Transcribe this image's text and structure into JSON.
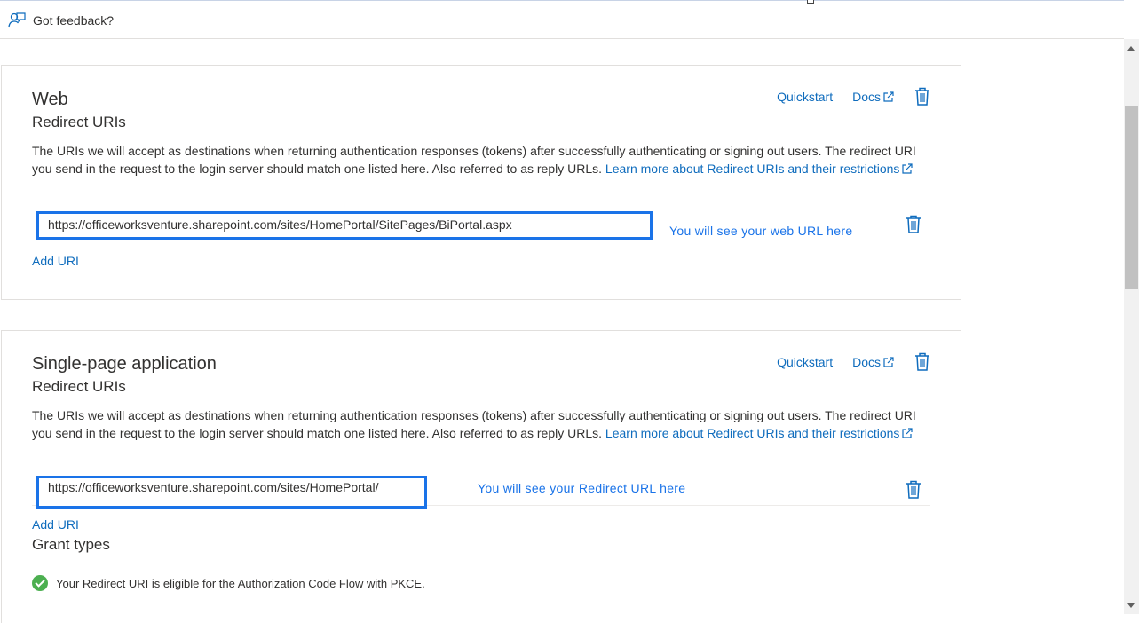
{
  "feedback": {
    "label": "Got feedback?"
  },
  "web": {
    "title": "Web",
    "subtitle": "Redirect URIs",
    "quickstart": "Quickstart",
    "docs": "Docs",
    "desc_1": "The URIs we will accept as destinations when returning authentication responses (tokens) after successfully authenticating or signing out users. The redirect URI you send in the request to the login server should match one listed here. Also referred to as reply URLs. ",
    "desc_link": "Learn more about Redirect URIs and their restrictions",
    "uri_value": "https://officeworksventure.sharepoint.com/sites/HomePortal/SitePages/BiPortal.aspx",
    "uri_note": "You will see your web URL here",
    "add_uri": "Add URI"
  },
  "spa": {
    "title": "Single-page application",
    "subtitle": "Redirect URIs",
    "quickstart": "Quickstart",
    "docs": "Docs",
    "desc_1": "The URIs we will accept as destinations when returning authentication responses (tokens) after successfully authenticating or signing out users. The redirect URI you send in the request to the login server should match one listed here. Also referred to as reply URLs. ",
    "desc_link": "Learn more about Redirect URIs and their restrictions",
    "uri_value": "https://officeworksventure.sharepoint.com/sites/HomePortal/",
    "uri_note": "You will see your Redirect URL here",
    "add_uri": "Add URI",
    "grant_types": "Grant types",
    "eligible_text": "Your Redirect URI is eligible for the Authorization Code Flow with PKCE."
  },
  "colors": {
    "link": "#0f6cbd",
    "highlight": "#1a73e8",
    "success": "#4caf50"
  }
}
